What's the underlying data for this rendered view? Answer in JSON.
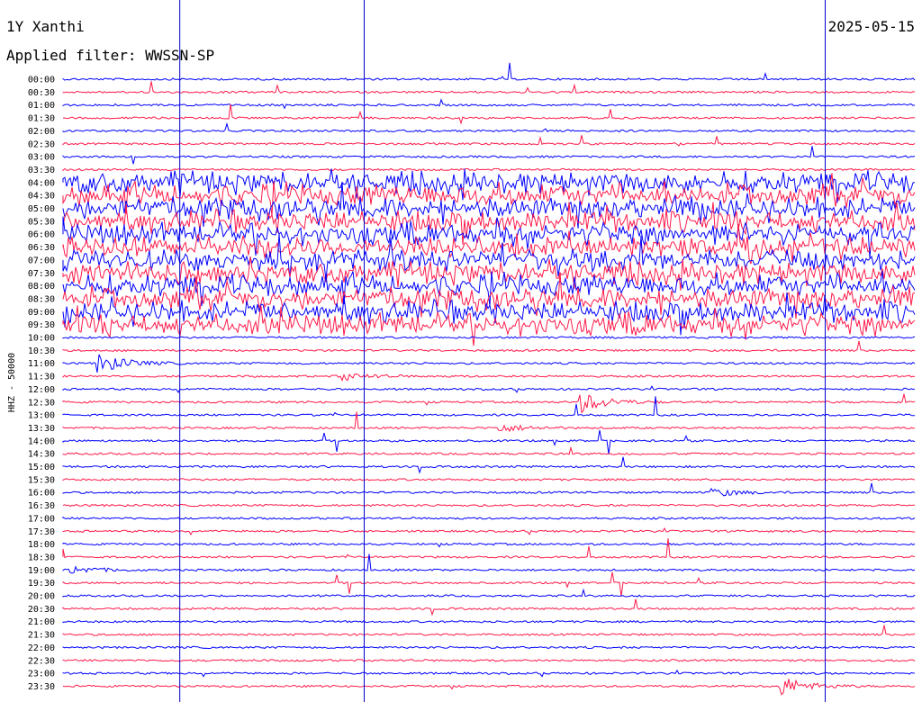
{
  "header": {
    "station": "1Y Xanthi",
    "date": "2025-05-15",
    "filter": "Applied filter: WWSSN-SP"
  },
  "colors": {
    "odd_row": "#0000ff",
    "even_row": "#ff1a4a",
    "marker": "#0000cc"
  },
  "chart_data": {
    "type": "line",
    "subtype": "helicorder",
    "ylabel": "HHZ - 50000",
    "row_labels": [
      "00:00",
      "00:30",
      "01:00",
      "01:30",
      "02:00",
      "02:30",
      "03:00",
      "03:30",
      "04:00",
      "04:30",
      "05:00",
      "05:30",
      "06:00",
      "06:30",
      "07:00",
      "07:30",
      "08:00",
      "08:30",
      "09:00",
      "09:30",
      "10:00",
      "10:30",
      "11:00",
      "11:30",
      "12:00",
      "12:30",
      "13:00",
      "13:30",
      "14:00",
      "14:30",
      "15:00",
      "15:30",
      "16:00",
      "16:30",
      "17:00",
      "17:30",
      "18:00",
      "18:30",
      "19:00",
      "19:30",
      "20:00",
      "20:30",
      "21:00",
      "21:30",
      "22:00",
      "22:30",
      "23:00",
      "23:30"
    ],
    "row_colors": [
      "blue",
      "red",
      "blue",
      "red",
      "blue",
      "red",
      "blue",
      "red",
      "blue",
      "red",
      "blue",
      "red",
      "blue",
      "red",
      "blue",
      "red",
      "blue",
      "red",
      "blue",
      "red",
      "blue",
      "red",
      "blue",
      "red",
      "blue",
      "red",
      "blue",
      "red",
      "blue",
      "red",
      "blue",
      "red",
      "blue",
      "red",
      "blue",
      "red",
      "blue",
      "red",
      "blue",
      "red",
      "blue",
      "red",
      "blue",
      "red",
      "blue",
      "red",
      "blue",
      "red"
    ],
    "noisy_rows": [
      "04:00",
      "04:30",
      "05:00",
      "05:30",
      "06:00",
      "06:30",
      "07:00",
      "07:30",
      "08:00",
      "08:30",
      "09:00",
      "09:30"
    ],
    "minute_markers": [
      0.195,
      0.395,
      0.895
    ],
    "events": [
      {
        "row": "11:00",
        "at_minute": 1.2,
        "amplitude": "large"
      },
      {
        "row": "11:30",
        "at_minute": 9.8,
        "amplitude": "small"
      },
      {
        "row": "12:30",
        "at_minute": 18.2,
        "amplitude": "large"
      },
      {
        "row": "13:30",
        "at_minute": 15.3,
        "amplitude": "small"
      },
      {
        "row": "16:00",
        "at_minute": 22.8,
        "amplitude": "small"
      },
      {
        "row": "19:00",
        "at_minute": 0.2,
        "amplitude": "small"
      },
      {
        "row": "23:30",
        "at_minute": 25.2,
        "amplitude": "large"
      }
    ]
  }
}
